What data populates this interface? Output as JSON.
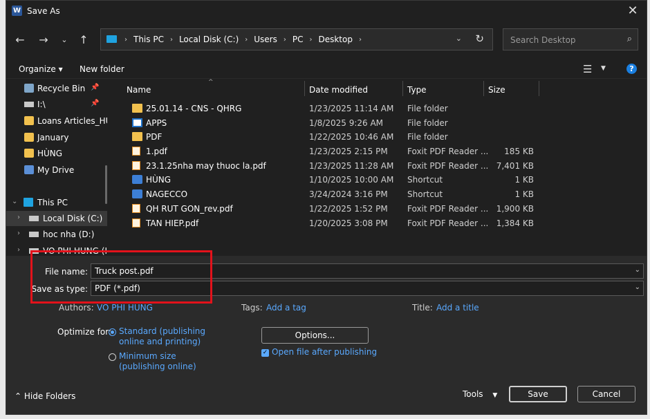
{
  "window": {
    "title": "Save As",
    "app_icon": "word-icon"
  },
  "nav": {
    "breadcrumbs": [
      "This PC",
      "Local Disk (C:)",
      "Users",
      "PC",
      "Desktop"
    ],
    "search_placeholder": "Search Desktop"
  },
  "commands": {
    "organize": "Organize ▾",
    "new_folder": "New folder"
  },
  "sidebar": {
    "items": [
      {
        "label": "Recycle Bin",
        "icon": "recycle-bin-icon",
        "pinned": true
      },
      {
        "label": "I:\\",
        "icon": "drive-icon",
        "pinned": true
      },
      {
        "label": "Loans Articles_HU",
        "icon": "user-folder-icon"
      },
      {
        "label": "January",
        "icon": "user-folder-icon"
      },
      {
        "label": "HÙNG",
        "icon": "user-folder-icon"
      },
      {
        "label": "My Drive",
        "icon": "drive-icon"
      },
      {
        "label": "This PC",
        "icon": "pc-icon"
      },
      {
        "label": "Local Disk (C:)",
        "icon": "disk-icon"
      },
      {
        "label": "hoc nha (D:)",
        "icon": "disk-icon"
      },
      {
        "label": "VO PHI HUNG (I",
        "icon": "disk-icon"
      }
    ]
  },
  "columns": {
    "name": "Name",
    "date": "Date modified",
    "type": "Type",
    "size": "Size"
  },
  "files": [
    {
      "name": "25.01.14 - CNS - QHRG",
      "date": "1/23/2025 11:14 AM",
      "type": "File folder",
      "size": "",
      "icon": "folder-icon"
    },
    {
      "name": "APPS",
      "date": "1/8/2025 9:26 AM",
      "type": "File folder",
      "size": "",
      "icon": "apps-folder-icon"
    },
    {
      "name": "PDF",
      "date": "1/22/2025 10:46 AM",
      "type": "File folder",
      "size": "",
      "icon": "folder-icon"
    },
    {
      "name": "1.pdf",
      "date": "1/23/2025 2:15 PM",
      "type": "Foxit PDF Reader ...",
      "size": "185 KB",
      "icon": "pdf-icon"
    },
    {
      "name": "23.1.25nha may thuoc la.pdf",
      "date": "1/23/2025 11:28 AM",
      "type": "Foxit PDF Reader ...",
      "size": "7,401 KB",
      "icon": "pdf-icon"
    },
    {
      "name": "HÙNG",
      "date": "1/10/2025 10:00 AM",
      "type": "Shortcut",
      "size": "1 KB",
      "icon": "shortcut-icon"
    },
    {
      "name": "NAGECCO",
      "date": "3/24/2024 3:16 PM",
      "type": "Shortcut",
      "size": "1 KB",
      "icon": "shortcut-icon"
    },
    {
      "name": "QH RUT GON_rev.pdf",
      "date": "1/22/2025 1:52 PM",
      "type": "Foxit PDF Reader ...",
      "size": "1,900 KB",
      "icon": "pdf-icon"
    },
    {
      "name": "TAN HIEP.pdf",
      "date": "1/20/2025 3:08 PM",
      "type": "Foxit PDF Reader ...",
      "size": "1,384 KB",
      "icon": "pdf-icon"
    }
  ],
  "form": {
    "file_name_label": "File name:",
    "file_name_value": "Truck post.pdf",
    "save_type_label": "Save as type:",
    "save_type_value": "PDF (*.pdf)",
    "authors_label": "Authors:",
    "authors_value": "VO PHI HUNG",
    "tags_label": "Tags:",
    "tags_value": "Add a tag",
    "title_label": "Title:",
    "title_value": "Add a title"
  },
  "optimize": {
    "label": "Optimize for:",
    "standard_line1": "Standard (publishing",
    "standard_line2": "online and printing)",
    "minimum_line1": "Minimum size",
    "minimum_line2": "(publishing online)",
    "selected": "standard"
  },
  "options_button": "Options...",
  "open_after": {
    "label": "Open file after publishing",
    "checked": true
  },
  "footer": {
    "hide_folders": "Hide Folders",
    "tools": "Tools",
    "save": "Save",
    "cancel": "Cancel"
  }
}
